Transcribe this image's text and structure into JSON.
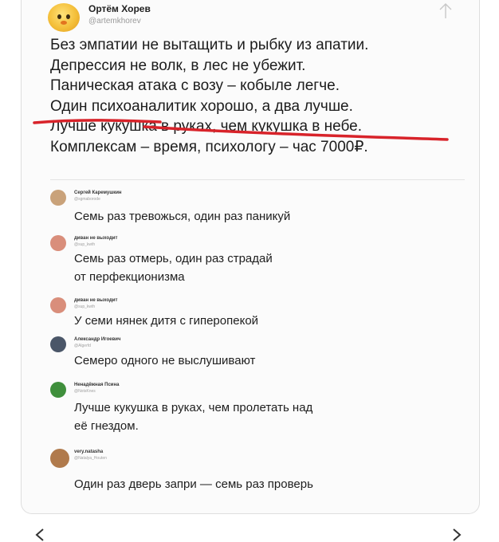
{
  "post": {
    "author": {
      "name": "Ортём Хорев",
      "handle": "@artemkhorev"
    },
    "lines": [
      "Без эмпатии не вытащить и рыбку из апатии.",
      "Депрессия не волк, в лес не убежит.",
      "Паническая атака с возу – кобыле легче.",
      "Один психоаналитик хорошо, а два лучше.",
      "Лучше кукушка в руках, чем кукушка в небе.",
      "Комплексам – время, психологу – час 7000₽."
    ]
  },
  "replies": [
    {
      "name": "Сергей Каремушкин",
      "handle": "@sgmaborode",
      "text": [
        "Семь раз тревожься, один раз паникуй"
      ],
      "avatar_color": "#c9a27a"
    },
    {
      "name": "диван не выходит",
      "handle": "@sup_kwth",
      "text": [
        "Семь раз отмерь, один раз страдай",
        "от перфекционизма"
      ],
      "avatar_color": "#d98e7b"
    },
    {
      "name": "диван не выходит",
      "handle": "@sup_kwth",
      "text": [
        "У семи нянек дитя с гиперопекой"
      ],
      "avatar_color": "#d98e7b"
    },
    {
      "name": "Александр Игоевич",
      "handle": "@Algerfd",
      "text": [
        "Семеро одного не выслушивают"
      ],
      "avatar_color": "#4a5668"
    },
    {
      "name": "Ненадёжная Псина",
      "handle": "@NotsKnes",
      "text": [
        "Лучше кукушка в руках, чем пролетать над",
        "её гнездом."
      ],
      "avatar_color": "#3f8f3c"
    },
    {
      "name": "very.natasha",
      "handle": "@Natalya_Houten",
      "text": [
        "Один раз дверь запри — семь раз проверь"
      ],
      "avatar_color": "#b07a4c"
    }
  ],
  "colors": {
    "strike": "#d8232a",
    "card_bg": "#fbfbfb",
    "text": "#1c1c1c",
    "muted": "#9a9a9a"
  },
  "icons": {
    "share": "share-arrow-icon",
    "prev": "chevron-left-icon",
    "next": "chevron-right-icon"
  }
}
